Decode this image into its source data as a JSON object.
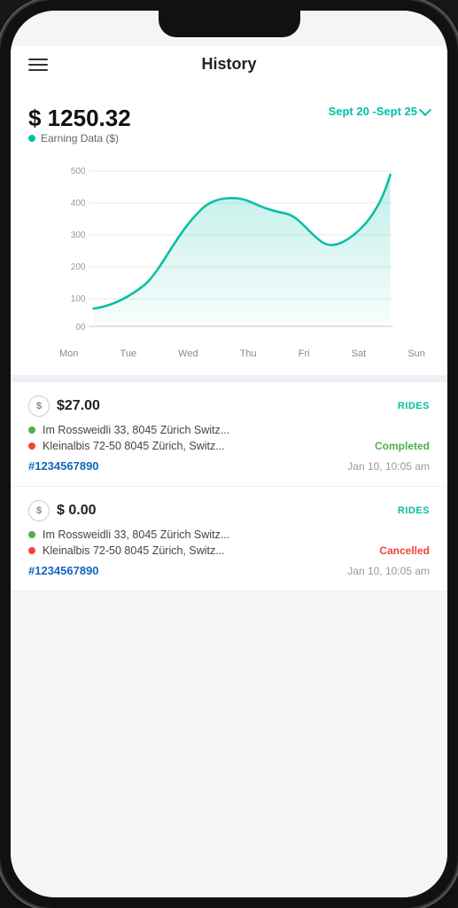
{
  "header": {
    "title": "History"
  },
  "chart": {
    "amount": "$ 1250.32",
    "date_range": "Sept 20 -Sept 25",
    "earning_label": "Earning Data ($)",
    "y_labels": [
      "00",
      "100",
      "200",
      "300",
      "400",
      "500"
    ],
    "x_labels": [
      "Mon",
      "Tue",
      "Wed",
      "Thu",
      "Fri",
      "Sat",
      "Sun"
    ],
    "accent_color": "#00bfa5"
  },
  "transactions": [
    {
      "amount": "$27.00",
      "type": "RIDES",
      "pickup": "Im Rossweidli 33, 8045 Zürich Switz...",
      "dropoff": "Kleinalbis 72-50 8045 Zürich, Switz...",
      "status": "Completed",
      "status_type": "completed",
      "id": "#1234567890",
      "time": "Jan 10, 10:05 am"
    },
    {
      "amount": "$ 0.00",
      "type": "RIDES",
      "pickup": "Im Rossweidli 33, 8045 Zürich Switz...",
      "dropoff": "Kleinalbis 72-50 8045 Zürich, Switz...",
      "status": "Cancelled",
      "status_type": "cancelled",
      "id": "#1234567890",
      "time": "Jan 10, 10:05 am"
    }
  ]
}
